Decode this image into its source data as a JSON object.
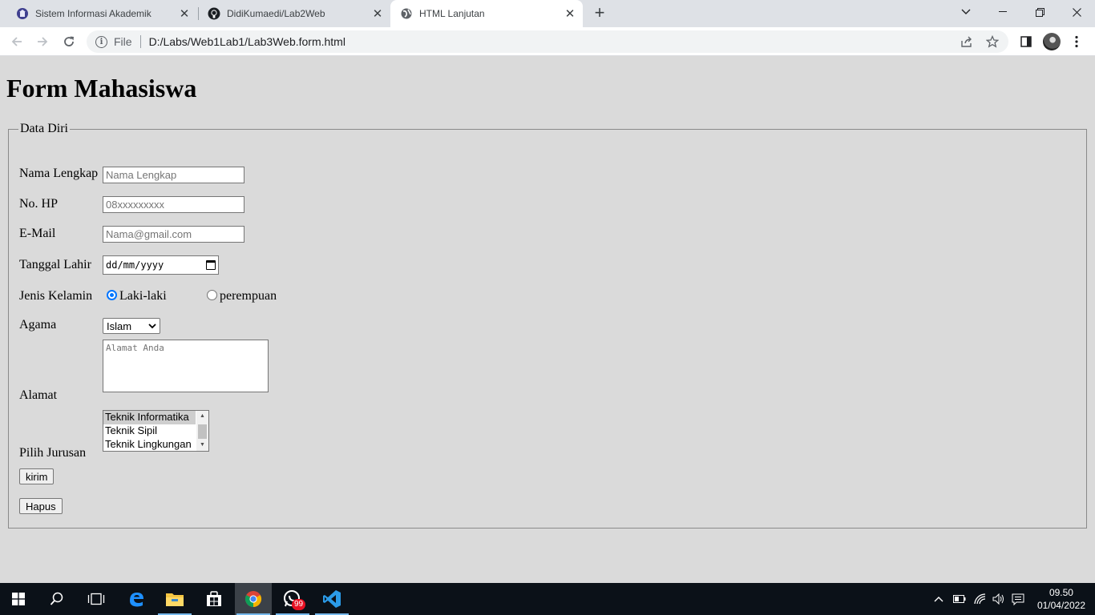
{
  "browser": {
    "tabs": [
      {
        "title": "Sistem Informasi Akademik",
        "icon": "university-icon"
      },
      {
        "title": "DidiKumaedi/Lab2Web",
        "icon": "github-icon"
      },
      {
        "title": "HTML Lanjutan",
        "icon": "globe-icon",
        "active": true
      }
    ],
    "address": {
      "scheme": "File",
      "url": "D:/Labs/Web1Lab1/Lab3Web.form.html"
    }
  },
  "page": {
    "heading": "Form Mahasiswa",
    "legend": "Data Diri",
    "labels": {
      "nama": "Nama Lengkap",
      "hp": "No. HP",
      "email": "E-Mail",
      "tanggal": "Tanggal Lahir",
      "jenis": "Jenis Kelamin",
      "agama": "Agama",
      "alamat": "Alamat",
      "jurusan": "Pilih Jurusan"
    },
    "placeholders": {
      "nama": "Nama Lengkap",
      "hp": "08xxxxxxxxx",
      "email": "Nama@gmail.com",
      "alamat": "Alamat Anda"
    },
    "date_placeholder": "dd/mm/yyyy",
    "gender": {
      "male": "Laki-laki",
      "female": "perempuan",
      "selected": "male"
    },
    "agama_selected": "Islam",
    "jurusan_options": [
      "Teknik Informatika",
      "Teknik Sipil",
      "Teknik Lingkungan"
    ],
    "jurusan_selected": "Teknik Informatika",
    "buttons": {
      "submit": "kirim",
      "reset": "Hapus"
    }
  },
  "taskbar": {
    "time": "09.50",
    "date": "01/04/2022",
    "whatsapp_badge": "99"
  }
}
